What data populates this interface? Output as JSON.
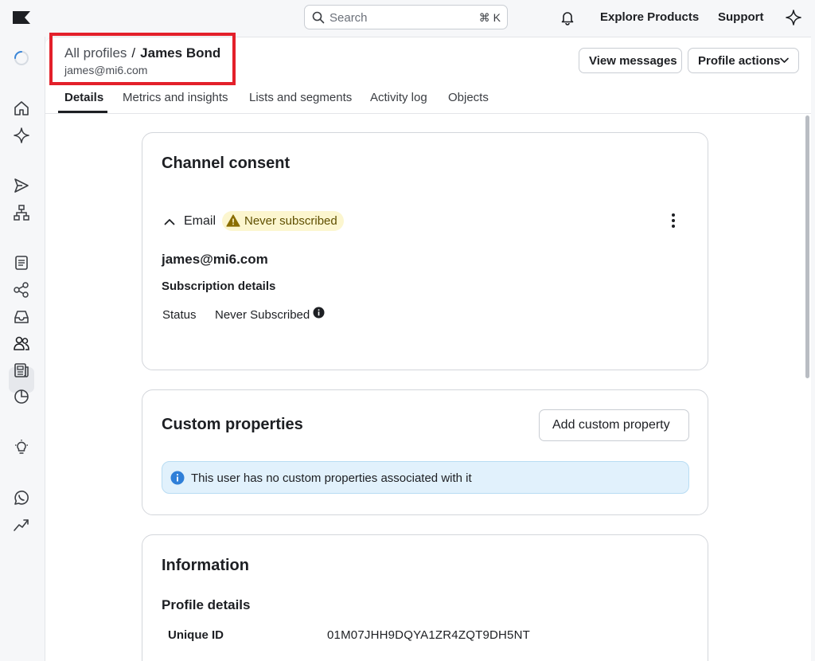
{
  "topbar": {
    "search_placeholder": "Search",
    "search_shortcut": "⌘ K",
    "explore_label": "Explore Products",
    "support_label": "Support"
  },
  "header": {
    "breadcrumb_parent": "All profiles",
    "breadcrumb_separator": "/",
    "breadcrumb_current": "James Bond",
    "profile_email": "james@mi6.com",
    "view_messages_label": "View messages",
    "profile_actions_label": "Profile actions"
  },
  "tabs": [
    {
      "label": "Details",
      "active": true
    },
    {
      "label": "Metrics and insights",
      "active": false
    },
    {
      "label": "Lists and segments",
      "active": false
    },
    {
      "label": "Activity log",
      "active": false
    },
    {
      "label": "Objects",
      "active": false
    }
  ],
  "channel_consent": {
    "title": "Channel consent",
    "channel_label": "Email",
    "badge_label": "Never subscribed",
    "email": "james@mi6.com",
    "subscription_details_label": "Subscription details",
    "status_label": "Status",
    "status_value": "Never Subscribed"
  },
  "custom_properties": {
    "title": "Custom properties",
    "add_button_label": "Add custom property",
    "notice_text": "This user has no custom properties associated with it"
  },
  "information": {
    "title": "Information",
    "profile_details_label": "Profile details",
    "unique_id_label": "Unique ID",
    "unique_id_value": "01M07JHH9DQYA1ZR4ZQT9DH5NT"
  },
  "colors": {
    "highlight": "#e3202a",
    "badge_bg": "#fcf6cf",
    "notice_bg": "#e1f1fc",
    "info_blue": "#2f7fd8"
  }
}
